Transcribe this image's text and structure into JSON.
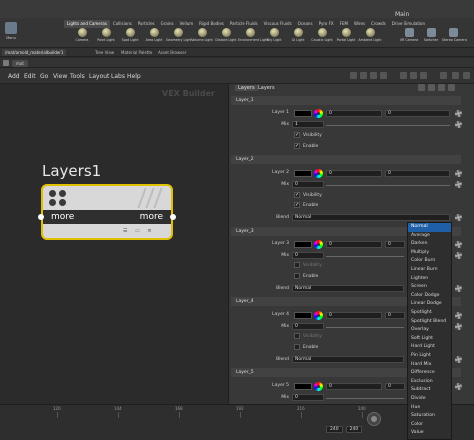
{
  "app": {
    "main_title": "Main"
  },
  "shelf": {
    "tabs": [
      "Lights and Cameras",
      "Collisions",
      "Particles",
      "Grains",
      "Vellum",
      "Rigid Bodies",
      "Particle Fluids",
      "Viscous Fluids",
      "Oceans",
      "Pyro FX",
      "FEM",
      "Wires",
      "Crowds",
      "Drive Simulation"
    ],
    "menu_tool_label": "Menu",
    "tools": [
      "Camera",
      "Point Light",
      "Spot Light",
      "Area Light",
      "Geometry Light",
      "Volume Light",
      "Distant Light",
      "Environment Light",
      "Sky Light",
      "GI Light",
      "Caustic Light",
      "Portal Light",
      "Ambient Light"
    ],
    "tools_right": [
      "VR Camera",
      "Switcher",
      "Stereo Camera"
    ]
  },
  "pane_tabs": [
    "/mat/arnold_materialbuilder1",
    "Tree View",
    "Material Palette",
    "Asset Browser"
  ],
  "path": {
    "segment": "mat"
  },
  "menubar": [
    "Add",
    "Edit",
    "Go",
    "View",
    "Tools",
    "Layout",
    "Labs",
    "Help"
  ],
  "network": {
    "context_label": "VEX Builder",
    "node_name": "Layers1",
    "node_input_label": "more",
    "node_output_label": "more"
  },
  "params": {
    "tab_layers": "Layers",
    "tab_name": "Layers",
    "sections": [
      {
        "header": "Layer_1",
        "color_label": "Layer 1",
        "color_value": "0",
        "color_value2": "0",
        "mix_label": "Mix",
        "mix_value": "1",
        "visibility_label": "Visibility",
        "enable_label": "Enable",
        "visibility_on": true,
        "enable_on": true
      },
      {
        "header": "Layer_2",
        "color_label": "Layer 2",
        "color_value": "0",
        "color_value2": "0",
        "mix_label": "Mix",
        "mix_value": "0",
        "visibility_label": "Visibility",
        "enable_label": "Enable",
        "blend_label": "Blend",
        "blend_value": "Normal",
        "visibility_on": true,
        "enable_on": true
      },
      {
        "header": "Layer_3",
        "color_label": "Layer 3",
        "color_value": "0",
        "color_value2": "0",
        "mix_label": "Mix",
        "mix_value": "0",
        "visibility_label": "Visibility",
        "enable_label": "Enable",
        "blend_label": "Blend",
        "blend_value": "Normal",
        "visibility_on": false,
        "enable_on": false
      },
      {
        "header": "Layer_4",
        "color_label": "Layer 4",
        "color_value": "0",
        "color_value2": "0",
        "mix_label": "Mix",
        "mix_value": "0",
        "visibility_label": "Visibility",
        "enable_label": "Enable",
        "blend_label": "Blend",
        "blend_value": "Normal",
        "visibility_on": false,
        "enable_on": false
      },
      {
        "header": "Layer_5",
        "color_label": "Layer 5",
        "color_value": "0",
        "color_value2": "0",
        "mix_label": "Mix",
        "mix_value": "0"
      }
    ]
  },
  "blend_dropdown": {
    "selected": "Normal",
    "options": [
      "Normal",
      "Average",
      "Darken",
      "Multiply",
      "Color Burn",
      "Linear Burn",
      "Lighten",
      "Screen",
      "Color Dodge",
      "Linear Dodge",
      "Spotlight",
      "Spotlight Blend",
      "Overlay",
      "Soft Light",
      "Hard Light",
      "Pin Light",
      "Hard Mix",
      "Difference",
      "Exclusion",
      "Subtract",
      "Divide",
      "Hue",
      "Saturation",
      "Color",
      "Value"
    ]
  },
  "timeline": {
    "ticks": [
      "120",
      "144",
      "168",
      "192",
      "216",
      "240"
    ],
    "range_start": "240",
    "range_end": "240"
  },
  "colors": {
    "node_border": "#e0c000",
    "selected_item": "#1e5fa8"
  }
}
